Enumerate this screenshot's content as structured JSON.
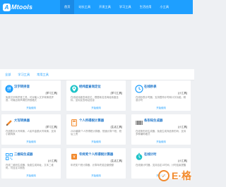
{
  "brand": {
    "logo_glyph": "A",
    "logo_text": "Mtools"
  },
  "nav": {
    "items": [
      {
        "label": "首页",
        "active": true
      },
      {
        "label": "站长工具"
      },
      {
        "label": "开发工具"
      },
      {
        "label": "学习工具"
      },
      {
        "label": "生活应用"
      },
      {
        "label": "小工具"
      }
    ]
  },
  "tabs": [
    "全部",
    "学习工具",
    "常用工具"
  ],
  "cards": [
    {
      "icon": "pinyin-icon",
      "icon_color": "#1e9fff",
      "title": "汉字转拼音",
      "tag": "[学习工具]",
      "desc": "免费汉字转拼音工具，可对输入文字转换成拼音，可输出带声调的拼音格式",
      "link": "开始使用"
    },
    {
      "icon": "map-pin-icon",
      "icon_color": "#1ec3c8",
      "title": "经纬度查询定位",
      "tag": "[学习工具]",
      "desc": "在线经纬度查询定位，根据地名查询经纬度坐标，坐标反查地址信息",
      "link": "开始使用"
    },
    {
      "icon": "clock-icon",
      "icon_color": "#1e9fff",
      "title": "在线秒表",
      "tag": "[小工具]",
      "desc": "在线秒表计时器，支持暂停计时和计次功能，精准计时",
      "link": "开始使用"
    },
    {
      "icon": "pencil-icon",
      "icon_color": "#f28b2f",
      "title": "大写转换器",
      "tag": "[学习工具]",
      "desc": "在线数字大写转换，人民币金额大写转换，支持小数转换",
      "link": "开始使用"
    },
    {
      "icon": "calculator-icon",
      "icon_color": "#f28b2f",
      "title": "个人所得税计算器",
      "tag": "[生活工具]",
      "desc": "2025最新个人所得税计算器，快速计算个税、税后工资",
      "link": "开始使用"
    },
    {
      "icon": "barcode-icon",
      "icon_color": "#333333",
      "title": "条形码生成器",
      "tag": "[小工具]",
      "desc": "在线条形码生成器，免费生成商品条形码，支持多种编码格式",
      "link": "开始使用"
    },
    {
      "icon": "qrcode-icon",
      "icon_color": "#1e9fff",
      "title": "二维码生成器",
      "tag": "[小工具]",
      "desc": "在线二维码生成器，免费生成网址、文本二维码，可自定义颜色",
      "link": "开始使用"
    },
    {
      "icon": "tax-icon",
      "icon_color": "#f28b2f",
      "title": "年终奖个人所得税计算器",
      "tag": "[生活工具]",
      "desc": "年终奖个税计算器，计算年终奖应缴税额",
      "link": "开始使用"
    },
    {
      "icon": "timer-icon",
      "icon_color": "#1ec3c8",
      "title": "在线计时",
      "tag": "[小工具]",
      "desc": "在线倒计时器，支持自定义时间，计时结束提醒",
      "link": "开始使用"
    }
  ],
  "watermark": {
    "glyph": "✓",
    "text": "E·格"
  }
}
